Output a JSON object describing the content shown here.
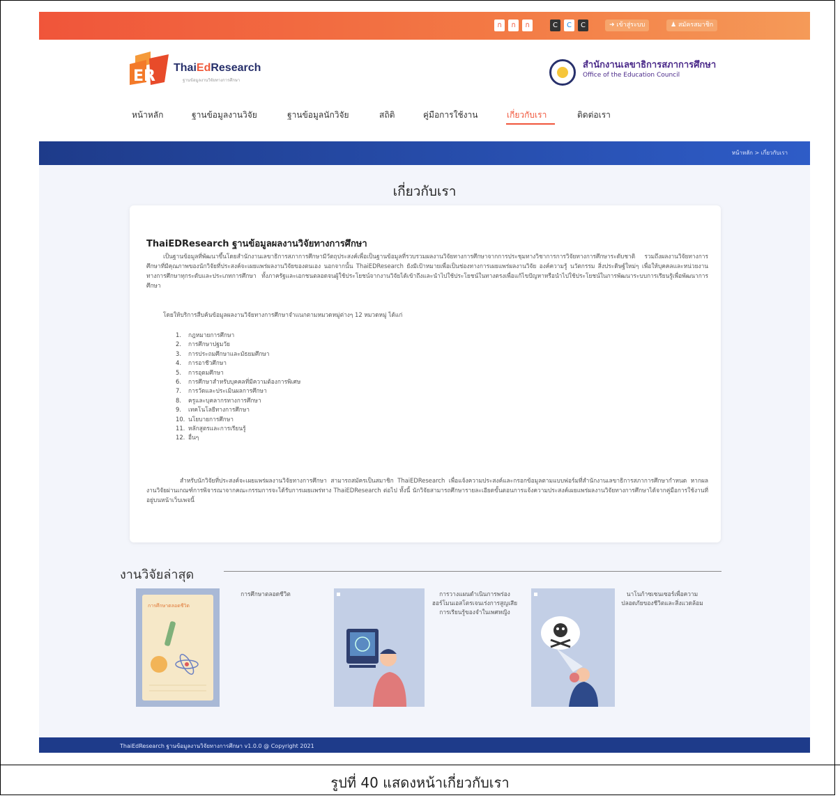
{
  "topbar": {
    "font_small": "ก",
    "font_medium": "ก",
    "font_large": "ก",
    "contrast_dark": "C",
    "contrast_light": "C",
    "contrast_default": "C",
    "login_label": "เข้าสู่ระบบ",
    "register_label": "สมัครสมาชิก"
  },
  "brand": {
    "name_prefix": "Thai",
    "name_ed": "Ed",
    "name_suffix": "Research",
    "tagline": "ฐานข้อมูลงานวิจัยทางการศึกษา"
  },
  "org": {
    "name_th": "สำนักงานเลขาธิการสภาการศึกษา",
    "name_en": "Office of the Education Council"
  },
  "nav": {
    "home": "หน้าหลัก",
    "research_db": "ฐานข้อมูลงานวิจัย",
    "researcher_db": "ฐานข้อมูลนักวิจัย",
    "stats": "สถิติ",
    "manual": "คู่มือการใช้งาน",
    "about": "เกี่ยวกับเรา",
    "contact": "ติดต่อเรา"
  },
  "breadcrumb": "หน้าหลัก > เกี่ยวกับเรา",
  "page_title": "เกี่ยวกับเรา",
  "about": {
    "heading": "ThaiEDResearch ฐานข้อมูลผลงานวิจัยทางการศึกษา",
    "intro": "เป็นฐานข้อมูลที่พัฒนาขึ้นโดยสำนักงานเลขาธิการสภาการศึกษามีวัตถุประสงค์เพื่อเป็นฐานข้อมูลที่รวบรวมผลงานวิจัยทางการศึกษาจากการประชุมทางวิชาการการวิจัยทางการศึกษาระดับชาติ รวมถึงผลงานวิจัยทางการศึกษาที่มีคุณภาพของนักวิจัยที่ประสงค์จะเผยแพร่ผลงานวิจัยของตนเอง นอกจากนั้น ThaiEDResearch ยังมีเป้าหมายเพื่อเป็นช่องทางการเผยแพร่ผลงานวิจัย องค์ความรู้ นวัตกรรม สิ่งประดิษฐ์ใหม่ๆ เพื่อให้บุคคลและหน่วยงานทางการศึกษาทุกระดับและประเภทการศึกษา ทั้งภาครัฐและเอกชนตลอดจนผู้ใช้ประโยชน์จากงานวิจัยได้เข้าถึงและนำไปใช้ประโยชน์ในทางตรงเพื่อแก้ไขปัญหาหรือนำไปใช้ประโยชน์ในการพัฒนาระบบการเรียนรู้เพื่อพัฒนาการศึกษา",
    "categories_intro": "โดยให้บริการสืบค้นข้อมูลผลงานวิจัยทางการศึกษาจำแนกตามหมวดหมู่ต่างๆ 12 หมวดหมู่ ได้แก่",
    "categories": [
      {
        "num": "1.",
        "label": "กฎหมายการศึกษา"
      },
      {
        "num": "2.",
        "label": "การศึกษาปฐมวัย"
      },
      {
        "num": "3.",
        "label": "การประถมศึกษาและมัธยมศึกษา"
      },
      {
        "num": "4.",
        "label": "การอาชีวศึกษา"
      },
      {
        "num": "5.",
        "label": "การอุดมศึกษา"
      },
      {
        "num": "6.",
        "label": "การศึกษาสำหรับบุคคลที่มีความต้องการพิเศษ"
      },
      {
        "num": "7.",
        "label": "การวัดและประเมินผลการศึกษา"
      },
      {
        "num": "8.",
        "label": "ครูและบุคลากรทางการศึกษา"
      },
      {
        "num": "9.",
        "label": "เทคโนโลยีทางการศึกษา"
      },
      {
        "num": "10.",
        "label": "นโยบายการศึกษา"
      },
      {
        "num": "11.",
        "label": "หลักสูตรและการเรียนรู้"
      },
      {
        "num": "12.",
        "label": "อื่นๆ"
      }
    ],
    "closing": "สำหรับนักวิจัยที่ประสงค์จะเผยแพร่ผลงานวิจัยทางการศึกษา สามารถสมัครเป็นสมาชิก ThaiEDResearch เพื่อแจ้งความประสงค์และกรอกข้อมูลตามแบบฟอร์มที่สำนักงานเลขาธิการสภาการศึกษากำหนด หากผลงานวิจัยผ่านเกณฑ์การพิจารณาจากคณะกรรมการจะได้รับการเผยแพร่ทาง ThaiEDResearch ต่อไป ทั้งนี้ นักวิจัยสามารถศึกษารายละเอียดขั้นตอนการแจ้งความประสงค์เผยแพร่ผลงานวิจัยทางการศึกษาได้จากคู่มือการใช้งานที่อยู่บนหน้าเว็บเพจนี้"
  },
  "latest": {
    "title": "งานวิจัยล่าสุด",
    "items": [
      {
        "title": "การศึกษาตลอดชีวิต",
        "cover_text": "การศึกษาตลอดชีวิต"
      },
      {
        "title": "การวางแผนดำเนินการพร่องฮอร์โมนเอสโตรเจนเร่งการสูญเสียการเรียนรู้ของจำในเพศหญิง"
      },
      {
        "title": "นาโนก้าซเซนเซอร์เพื่อความปลอดภัยของชีวิตและสิ่งแวดล้อม"
      }
    ]
  },
  "footer": "ThaiEdResearch ฐานข้อมูลงานวิจัยทางการศึกษา v1.0.0 @ Copyright 2021",
  "caption": "รูปที่ 40 แสดงหน้าเกี่ยวกับเรา",
  "colors": {
    "accent": "#f0553a",
    "brand_navy": "#1e3b8a"
  }
}
